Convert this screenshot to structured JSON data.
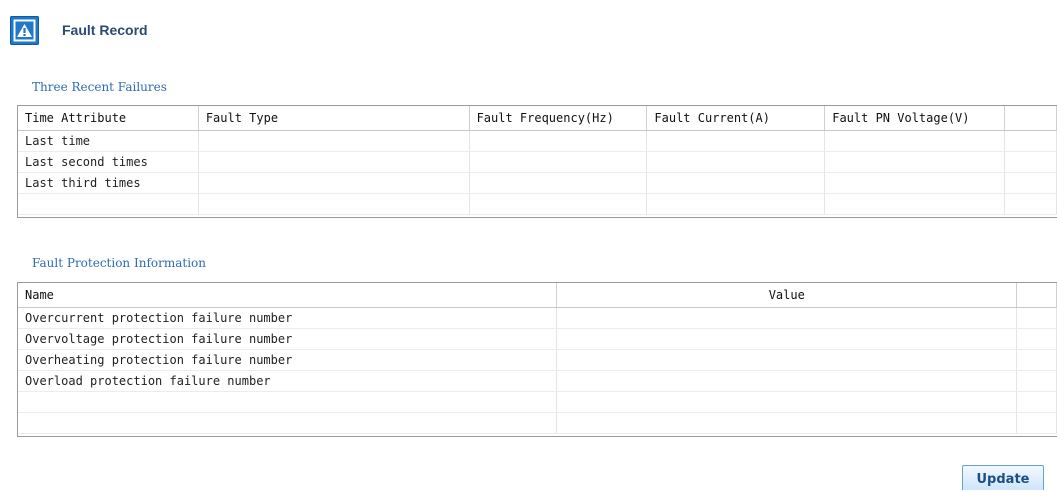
{
  "header": {
    "title": "Fault Record",
    "icon": "fault-warning-icon"
  },
  "recent_failures": {
    "title": "Three Recent Failures",
    "columns": [
      "Time Attribute",
      "Fault Type",
      "Fault Frequency(Hz)",
      "Fault Current(A)",
      "Fault PN Voltage(V)",
      ""
    ],
    "rows": [
      [
        "Last time",
        "",
        "",
        "",
        "",
        ""
      ],
      [
        "Last second times",
        "",
        "",
        "",
        "",
        ""
      ],
      [
        "Last third times",
        "",
        "",
        "",
        "",
        ""
      ],
      [
        "",
        "",
        "",
        "",
        "",
        ""
      ]
    ]
  },
  "protection": {
    "title": "Fault Protection Information",
    "columns": [
      "Name",
      "Value",
      ""
    ],
    "rows": [
      [
        "Overcurrent protection failure number",
        "",
        ""
      ],
      [
        "Overvoltage protection failure number",
        "",
        ""
      ],
      [
        "Overheating protection failure number",
        "",
        ""
      ],
      [
        "Overload protection failure number",
        "",
        ""
      ],
      [
        "",
        "",
        ""
      ],
      [
        "",
        "",
        ""
      ]
    ]
  },
  "actions": {
    "update_label": "Update"
  }
}
